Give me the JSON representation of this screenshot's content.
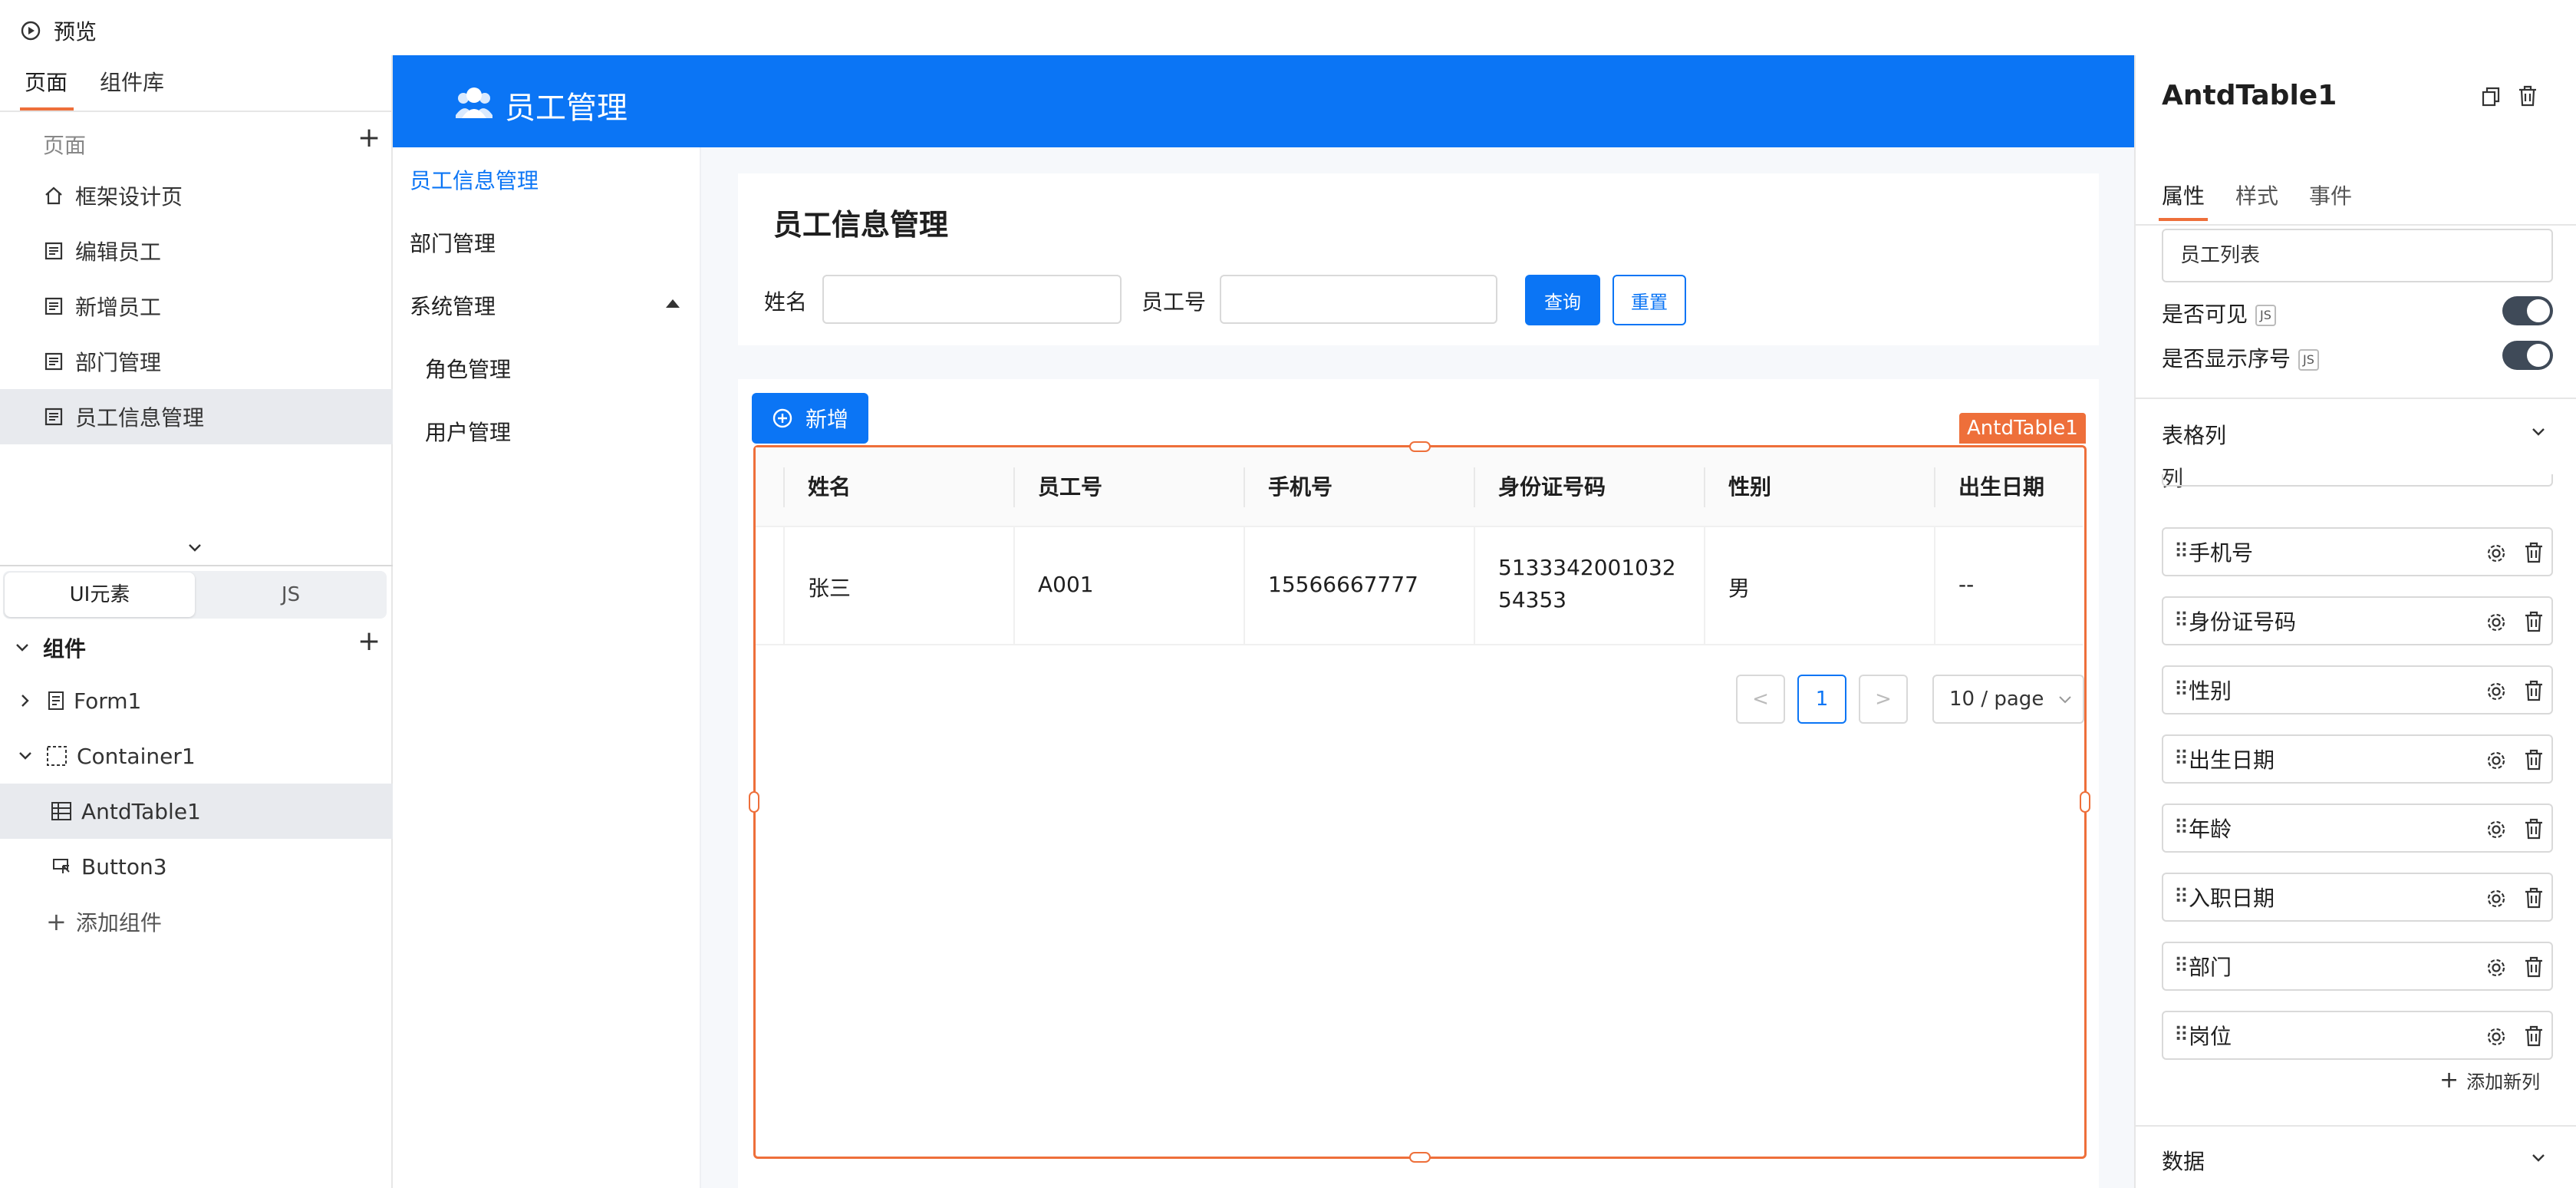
{
  "topbar": {
    "preview_label": "预览"
  },
  "left_panel": {
    "tabs": [
      {
        "label": "页面"
      },
      {
        "label": "组件库"
      }
    ],
    "pages_header": "页面",
    "pages": [
      {
        "label": "框架设计页",
        "icon": "home-icon"
      },
      {
        "label": "编辑员工",
        "icon": "page-icon"
      },
      {
        "label": "新增员工",
        "icon": "page-icon"
      },
      {
        "label": "部门管理",
        "icon": "page-icon"
      },
      {
        "label": "员工信息管理",
        "icon": "page-icon",
        "selected": true
      }
    ],
    "subtabs": [
      {
        "label": "UI元素"
      },
      {
        "label": "JS"
      }
    ],
    "components_header": "组件",
    "tree": [
      {
        "label": "Form1",
        "icon": "form-icon"
      },
      {
        "label": "Container1",
        "icon": "container-icon"
      },
      {
        "label": "AntdTable1",
        "icon": "table-icon",
        "selected": true
      },
      {
        "label": "Button3",
        "icon": "button-icon"
      }
    ],
    "add_component": "添加组件"
  },
  "app": {
    "header_title": "员工管理",
    "colors": {
      "primary": "#0b75f5",
      "selection": "#ee6f3a"
    },
    "menu": [
      {
        "label": "员工信息管理",
        "active": true
      },
      {
        "label": "部门管理"
      },
      {
        "label": "系统管理"
      },
      {
        "label": "角色管理"
      },
      {
        "label": "用户管理"
      }
    ],
    "page_title": "员工信息管理",
    "search": {
      "name_label": "姓名",
      "name_value": "",
      "id_label": "员工号",
      "id_value": "",
      "query_button": "查询",
      "reset_button": "重置"
    },
    "add_button": "新增",
    "selection_tag": "AntdTable1",
    "table": {
      "columns": [
        "姓名",
        "员工号",
        "手机号",
        "身份证号码",
        "性别",
        "出生日期"
      ],
      "rows": [
        {
          "name": "张三",
          "id": "A001",
          "phone": "15566667777",
          "id_card_line1": "5133342001032",
          "id_card_line2": "54353",
          "gender": "男",
          "birth": "--"
        }
      ]
    },
    "pagination": {
      "prev": "<",
      "current": "1",
      "next": ">",
      "page_size": "10 / page"
    }
  },
  "right_panel": {
    "title": "AntdTable1",
    "tabs": [
      {
        "label": "属性"
      },
      {
        "label": "样式"
      },
      {
        "label": "事件"
      }
    ],
    "title_input_value": "员工列表",
    "visible_label": "是否可见",
    "show_index_label": "是否显示序号",
    "js_badge": "JS",
    "columns_section": "表格列",
    "column_label": "列",
    "columns": [
      "手机号",
      "身份证号码",
      "性别",
      "出生日期",
      "年龄",
      "入职日期",
      "部门",
      "岗位"
    ],
    "add_column": "添加新列",
    "data_section": "数据"
  }
}
